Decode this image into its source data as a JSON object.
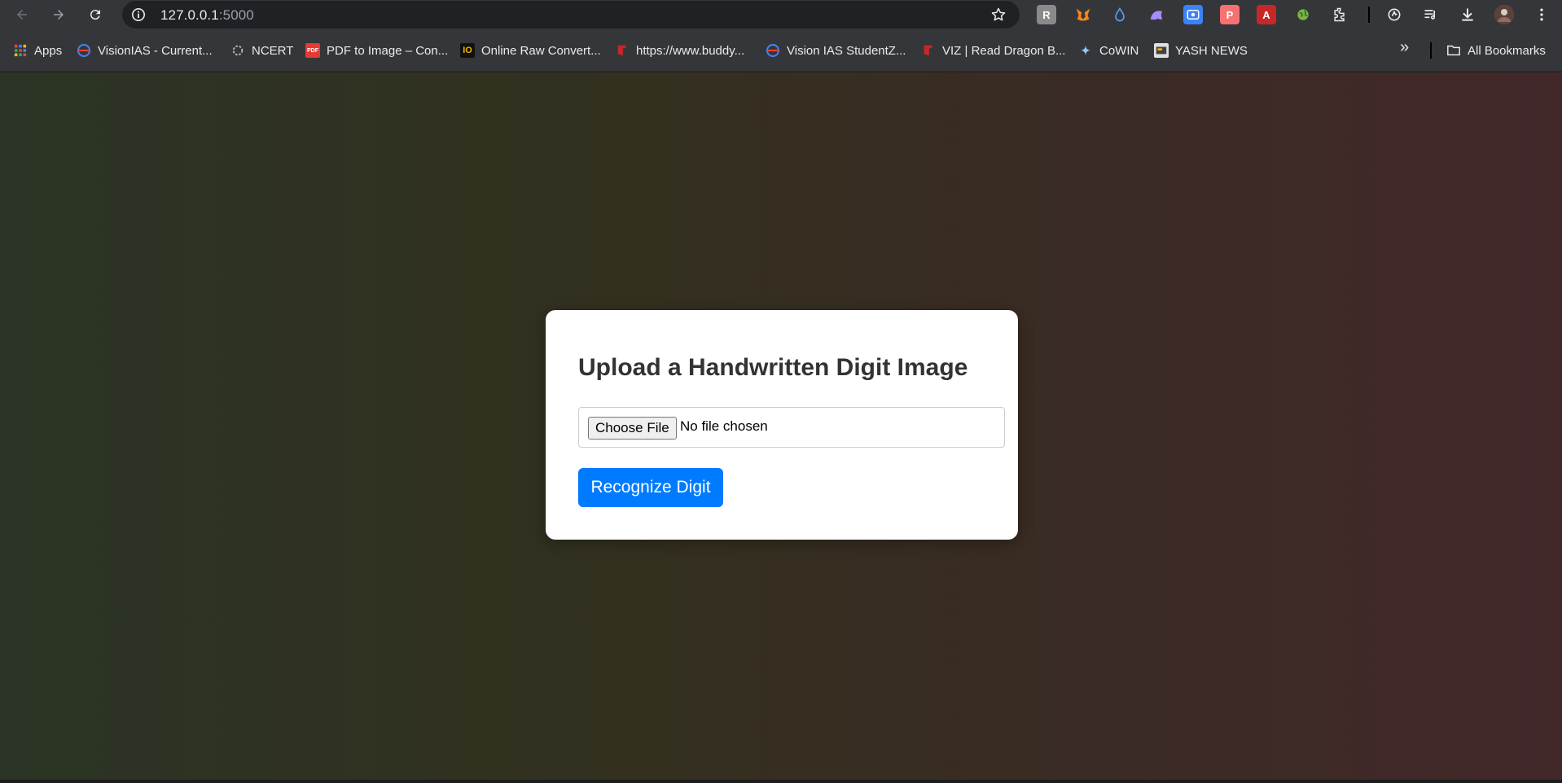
{
  "browser": {
    "url_host": "127.0.0.1",
    "url_port": ":5000",
    "icons": {
      "back": "back-arrow-icon",
      "forward": "forward-arrow-icon",
      "reload": "reload-icon",
      "site_info": "info-icon",
      "bookmark_star": "star-icon"
    },
    "extensions": [
      {
        "name": "rubber-stamp-extension-icon",
        "glyph": "R",
        "bg": "#8a8a8a",
        "fg": "#ffffff"
      },
      {
        "name": "metamask-fox-icon",
        "glyph": "🦊",
        "bg": "transparent",
        "fg": "#f6851b"
      },
      {
        "name": "raindrop-icon",
        "glyph": "💧",
        "bg": "transparent",
        "fg": "#4fa3ff"
      },
      {
        "name": "ghost-extension-icon",
        "glyph": "👻",
        "bg": "transparent",
        "fg": "#a78bfa"
      },
      {
        "name": "screen-recorder-icon",
        "glyph": "◉",
        "bg": "#3b82f6",
        "fg": "#ffffff"
      },
      {
        "name": "p-extension-icon",
        "glyph": "P",
        "bg": "#f87171",
        "fg": "#ffffff"
      },
      {
        "name": "acrobat-icon",
        "glyph": "A",
        "bg": "#c62828",
        "fg": "#ffffff"
      },
      {
        "name": "world-map-extension-icon",
        "glyph": "🌍",
        "bg": "transparent",
        "fg": "#7cb342"
      },
      {
        "name": "extensions-puzzle-icon",
        "glyph": "⧉",
        "bg": "transparent",
        "fg": "#e8eaed"
      }
    ],
    "right_icons": [
      "sync-icon",
      "media-queue-icon",
      "download-icon",
      "profile-avatar",
      "kebab-menu-icon"
    ]
  },
  "bookmarks": {
    "items": [
      {
        "label": "Apps",
        "icon": "apps-grid-icon"
      },
      {
        "label": "VisionIAS - Current...",
        "icon": "visionias-icon"
      },
      {
        "label": "NCERT",
        "icon": "ncert-icon"
      },
      {
        "label": "PDF to Image – Con...",
        "icon": "pdf-img-icon"
      },
      {
        "label": "Online Raw Convert...",
        "icon": "raw-convert-icon"
      },
      {
        "label": "https://www.buddy...",
        "icon": "bookmark-red-icon"
      },
      {
        "label": "Vision IAS StudentZ...",
        "icon": "visionias-icon"
      },
      {
        "label": "VIZ | Read Dragon B...",
        "icon": "viz-icon"
      },
      {
        "label": "CoWIN",
        "icon": "cowin-icon"
      },
      {
        "label": "YASH NEWS",
        "icon": "yash-news-icon"
      }
    ],
    "overflow_label": "»",
    "all_bookmarks": "All Bookmarks"
  },
  "page": {
    "heading": "Upload a Handwritten Digit Image",
    "file_input": {
      "button_label": "Choose File",
      "status": "No file chosen"
    },
    "submit_label": "Recognize Digit",
    "accent": "#007bff"
  }
}
